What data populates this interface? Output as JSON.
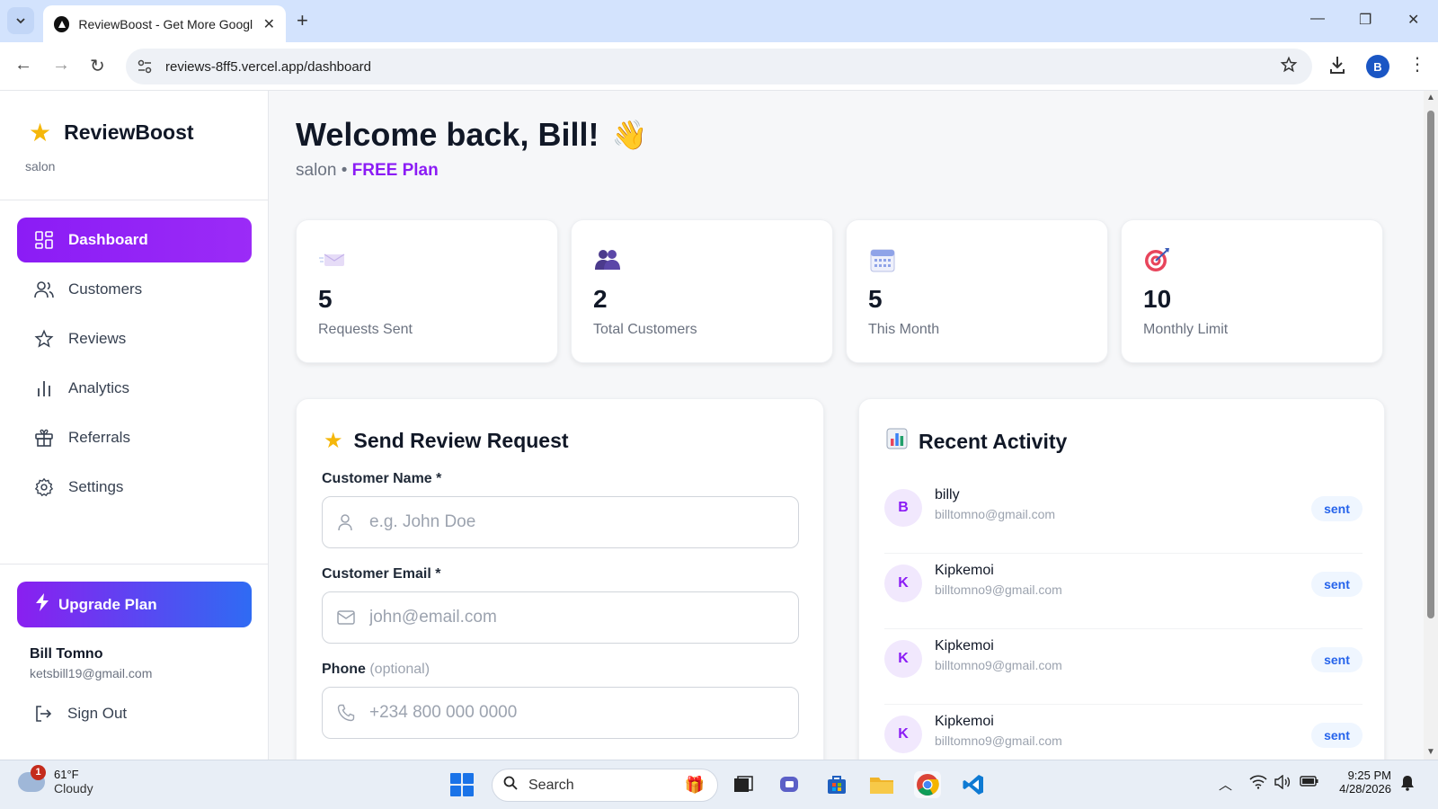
{
  "browser": {
    "tab_title": "ReviewBoost - Get More Google",
    "url": "reviews-8ff5.vercel.app/dashboard",
    "profile_initial": "B"
  },
  "sidebar": {
    "brand": "ReviewBoost",
    "business_type": "salon",
    "items": [
      {
        "label": "Dashboard",
        "icon": "dashboard-icon",
        "active": true
      },
      {
        "label": "Customers",
        "icon": "users-icon"
      },
      {
        "label": "Reviews",
        "icon": "star-icon"
      },
      {
        "label": "Analytics",
        "icon": "bar-chart-icon"
      },
      {
        "label": "Referrals",
        "icon": "gift-icon"
      },
      {
        "label": "Settings",
        "icon": "gear-icon"
      }
    ],
    "upgrade_label": "Upgrade Plan",
    "user_name": "Bill Tomno",
    "user_email": "ketsbill19@gmail.com",
    "signout_label": "Sign Out"
  },
  "header": {
    "welcome": "Welcome back, Bill!",
    "wave": "👋",
    "business": "salon",
    "separator": "•",
    "plan": "FREE Plan"
  },
  "stats": [
    {
      "value": "5",
      "label": "Requests Sent",
      "icon": "envelope-icon"
    },
    {
      "value": "2",
      "label": "Total Customers",
      "icon": "people-icon"
    },
    {
      "value": "5",
      "label": "This Month",
      "icon": "calendar-icon"
    },
    {
      "value": "10",
      "label": "Monthly Limit",
      "icon": "target-icon"
    }
  ],
  "send_request": {
    "title": "Send Review Request",
    "name_label": "Customer Name *",
    "name_placeholder": "e.g. John Doe",
    "email_label": "Customer Email *",
    "email_placeholder": "john@email.com",
    "phone_label": "Phone",
    "phone_optional": "(optional)",
    "phone_placeholder": "+234 800 000 0000"
  },
  "recent_activity": {
    "title": "Recent Activity",
    "items": [
      {
        "initial": "B",
        "name": "billy",
        "email": "billtomno@gmail.com",
        "status": "sent"
      },
      {
        "initial": "K",
        "name": "Kipkemoi",
        "email": "billtomno9@gmail.com",
        "status": "sent"
      },
      {
        "initial": "K",
        "name": "Kipkemoi",
        "email": "billtomno9@gmail.com",
        "status": "sent"
      },
      {
        "initial": "K",
        "name": "Kipkemoi",
        "email": "billtomno9@gmail.com",
        "status": "sent"
      }
    ]
  },
  "taskbar": {
    "weather_temp": "61°F",
    "weather_cond": "Cloudy",
    "weather_badge": "1",
    "search_label": "Search",
    "time": "9:25 PM",
    "date": "4/28/2026"
  },
  "colors": {
    "accent": "#8b1cf5",
    "upgrade_gradient_end": "#2f6bf3",
    "badge_text": "#2563eb"
  }
}
